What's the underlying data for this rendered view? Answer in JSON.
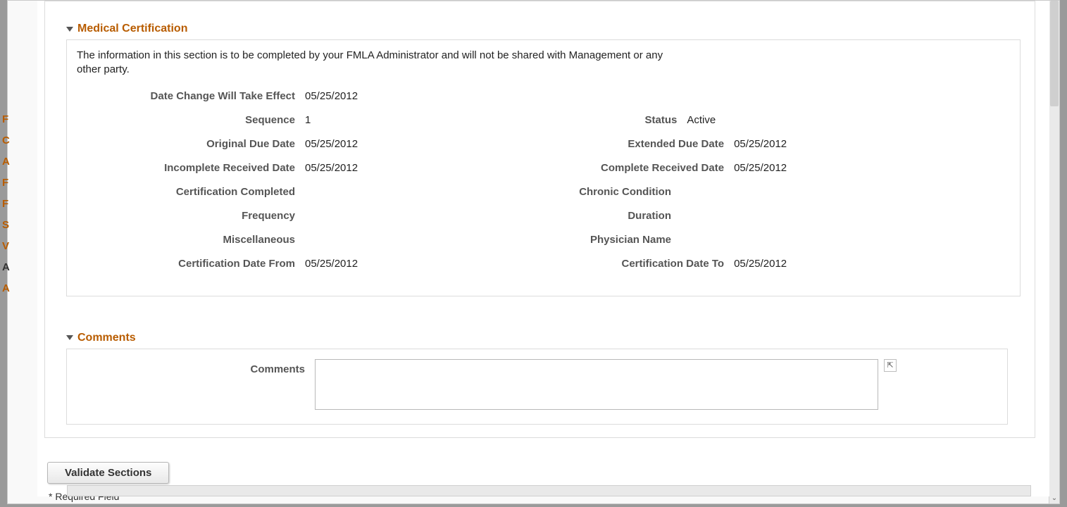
{
  "sections": {
    "medical": {
      "title": "Medical Certification",
      "info": "The information in this section is to be completed by your FMLA Administrator and will not be shared with Management or any other party.",
      "labels": {
        "date_change": "Date Change Will Take Effect",
        "sequence": "Sequence",
        "status": "Status",
        "original_due": "Original Due Date",
        "extended_due": "Extended Due Date",
        "incomplete_recv": "Incomplete Received Date",
        "complete_recv": "Complete Received Date",
        "cert_completed": "Certification Completed",
        "chronic": "Chronic Condition",
        "frequency": "Frequency",
        "duration": "Duration",
        "misc": "Miscellaneous",
        "physician": "Physician Name",
        "cert_from": "Certification Date From",
        "cert_to": "Certification Date To"
      },
      "values": {
        "date_change": "05/25/2012",
        "sequence": "1",
        "status": "Active",
        "original_due": "05/25/2012",
        "extended_due": "05/25/2012",
        "incomplete_recv": "05/25/2012",
        "complete_recv": "05/25/2012",
        "cert_completed": "",
        "chronic": "",
        "frequency": "",
        "duration": "",
        "misc": "",
        "physician": "",
        "cert_from": "05/25/2012",
        "cert_to": "05/25/2012"
      }
    },
    "comments": {
      "title": "Comments",
      "label": "Comments",
      "value": ""
    }
  },
  "footer": {
    "validate_button": "Validate Sections",
    "required_note": "* Required Field"
  }
}
